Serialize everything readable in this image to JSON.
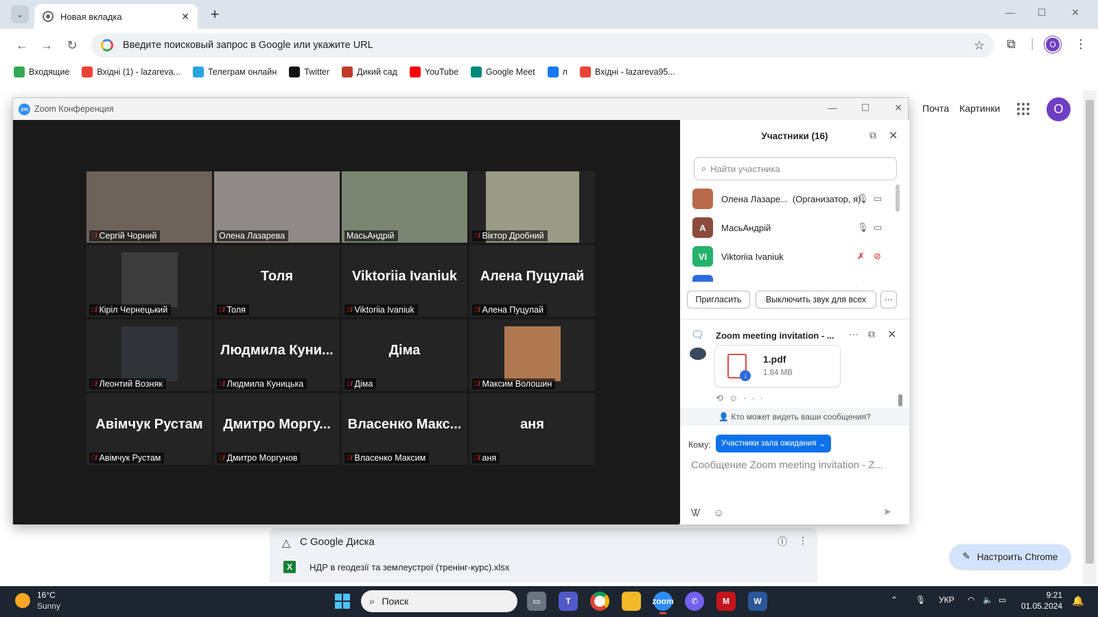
{
  "browser": {
    "tab_title": "Новая вкладка",
    "omnibox_placeholder": "Введите поисковый запрос в Google или укажите URL",
    "bookmarks": [
      {
        "label": "Входящие",
        "icon": "mail-box-icon",
        "color": "#34a853"
      },
      {
        "label": "Вхідні (1) - lazareva...",
        "icon": "gmail-icon",
        "color": "#ea4335"
      },
      {
        "label": "Телеграм онлайн",
        "icon": "telegram-icon",
        "color": "#2aa3df"
      },
      {
        "label": "Twitter",
        "icon": "x-icon",
        "color": "#111111"
      },
      {
        "label": "Дикий сад",
        "icon": "garden-icon",
        "color": "#c0392b"
      },
      {
        "label": "YouTube",
        "icon": "youtube-icon",
        "color": "#ff0000"
      },
      {
        "label": "Google Meet",
        "icon": "meet-icon",
        "color": "#00897b"
      },
      {
        "label": "л",
        "icon": "facebook-icon",
        "color": "#1877f2"
      },
      {
        "label": "Вхідні - lazareva95...",
        "icon": "gmail-icon",
        "color": "#ea4335"
      }
    ],
    "profile_letter": "O"
  },
  "google_page": {
    "mail_link": "Почта",
    "images_link": "Картинки",
    "profile_letter": "O",
    "drive_title": "С Google Диска",
    "drive_file": "НДР в геодезії та землеустрої (тренінг-курс).xlsx",
    "customize_button": "Настроить Chrome"
  },
  "zoom": {
    "window_title": "Zoom Конференция",
    "logo_text": "zm",
    "tiles": [
      {
        "big_name": "",
        "label": "Сергій Чорний",
        "muted": true,
        "video": true,
        "video_color": "#6d6259"
      },
      {
        "big_name": "",
        "label": "Олена Лазарева",
        "muted": false,
        "video": true,
        "active": true,
        "video_color": "#8f8a86"
      },
      {
        "big_name": "",
        "label": "МасьАндрій",
        "muted": false,
        "video": true,
        "video_color": "#7a8572"
      },
      {
        "big_name": "",
        "label": "Віктор Дробний",
        "muted": true,
        "video": true,
        "video_color": "#9a9b86"
      },
      {
        "big_name": "",
        "label": "Кірiл Чернецький",
        "muted": true,
        "video": true,
        "video_color": "#3c3c3c"
      },
      {
        "big_name": "Толя",
        "label": "Толя",
        "muted": true,
        "video": false
      },
      {
        "big_name": "Viktoriia Ivaniuk",
        "label": "Viktoriia Ivaniuk",
        "muted": true,
        "video": false
      },
      {
        "big_name": "Алена Пуцулай",
        "label": "Алена Пуцулай",
        "muted": true,
        "video": false
      },
      {
        "big_name": "",
        "label": "Леонтий Возняк",
        "muted": true,
        "video": true,
        "video_color": "#2f3338"
      },
      {
        "big_name": "Людмила Куни...",
        "label": "Людмила Куницька",
        "muted": true,
        "video": false
      },
      {
        "big_name": "Діма",
        "label": "Діма",
        "muted": true,
        "video": false
      },
      {
        "big_name": "",
        "label": "Максим Волошин",
        "muted": true,
        "video": true,
        "video_color": "#b07850"
      },
      {
        "big_name": "Авімчук Рустам",
        "label": "Авімчук Рустам",
        "muted": true,
        "video": false
      },
      {
        "big_name": "Дмитро Моргу...",
        "label": "Дмитро Моргунов",
        "muted": true,
        "video": false
      },
      {
        "big_name": "Власенко Макс...",
        "label": "Власенко Максим",
        "muted": true,
        "video": false
      },
      {
        "big_name": "аня",
        "label": "аня",
        "muted": true,
        "video": false
      }
    ],
    "participants": {
      "title": "Участники (16)",
      "search_placeholder": "Найти участника",
      "list": [
        {
          "initial": "",
          "name": "Олена Лазаре...",
          "role": "(Организатор, я)",
          "color": "#b86a4a",
          "muted": false,
          "video_off": false
        },
        {
          "initial": "A",
          "name": "МасьАндрій",
          "role": "",
          "color": "#8a4b3c",
          "muted": false,
          "video_off": false
        },
        {
          "initial": "VI",
          "name": "Viktoriia Ivaniuk",
          "role": "",
          "color": "#25b36b",
          "muted": true,
          "video_off": true
        },
        {
          "initial": "",
          "name": "",
          "role": "",
          "color": "#2d6cdf",
          "muted": true,
          "video_off": true
        }
      ],
      "invite_button": "Пригласить",
      "mute_all_button": "Выключить звук для всех",
      "more_button": "···"
    },
    "chat": {
      "title": "Zoom meeting invitation - ...",
      "file_name": "1.pdf",
      "file_size": "1.84 MB",
      "visibility_text": "Кто может видеть ваши сообщения?",
      "to_label": "Кому:",
      "to_value": "Участники зала ожидания",
      "message_placeholder": "Сообщение Zoom meeting invitation - Z..."
    }
  },
  "taskbar": {
    "temperature": "16°C",
    "weather": "Sunny",
    "search_label": "Поиск",
    "language": "УКР",
    "time": "9:21",
    "date": "01.05.2024"
  }
}
